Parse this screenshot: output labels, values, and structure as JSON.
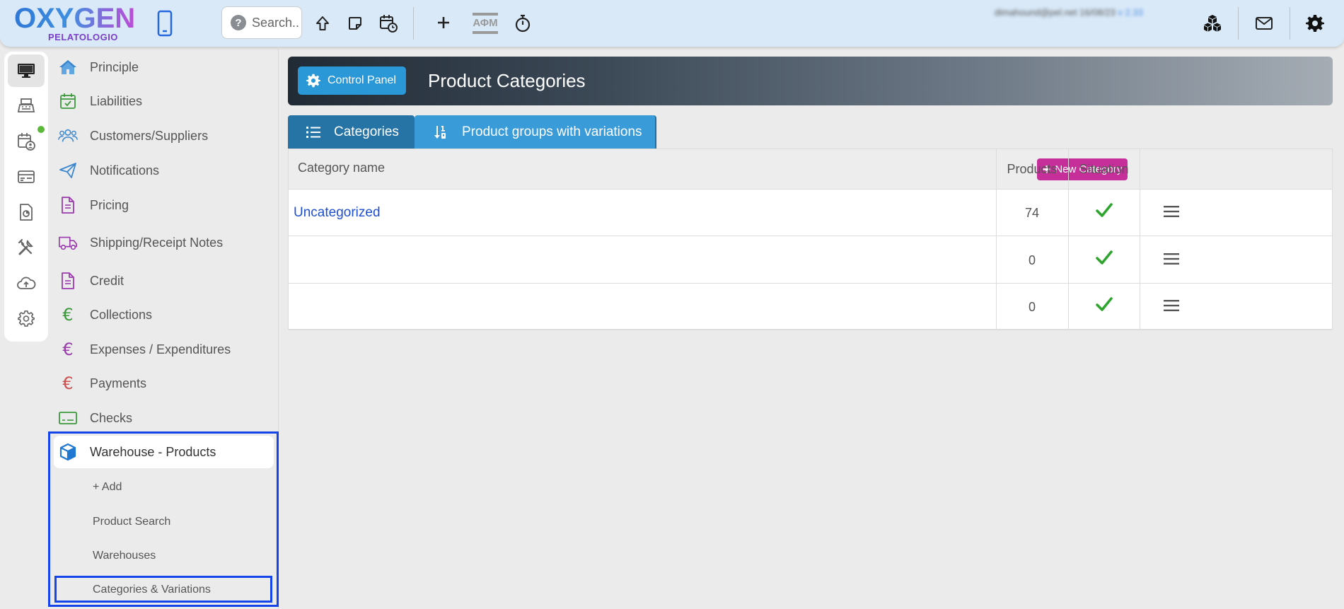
{
  "brand": {
    "name": "OXYGEN",
    "sub": "PELATOLOGIO"
  },
  "topbar": {
    "search_placeholder": "Search..",
    "afm_label": "ΑΦΜ",
    "user_email": "dimahound@pel.net 16/08/23",
    "version": "v 2.33"
  },
  "sidebar": {
    "items": [
      {
        "label": "Principle"
      },
      {
        "label": "Liabilities"
      },
      {
        "label": "Customers/Suppliers"
      },
      {
        "label": "Notifications"
      },
      {
        "label": "Pricing"
      },
      {
        "label": "Shipping/Receipt Notes"
      },
      {
        "label": "Credit"
      },
      {
        "label": "Collections"
      },
      {
        "label": "Expenses / Expenditures"
      },
      {
        "label": "Payments"
      },
      {
        "label": "Checks"
      },
      {
        "label": "Warehouse - Products"
      }
    ],
    "sub_items": [
      {
        "label": "+ Add"
      },
      {
        "label": "Product Search"
      },
      {
        "label": "Warehouses"
      },
      {
        "label": "Categories & Variations"
      }
    ]
  },
  "header": {
    "control_panel": "Control Panel",
    "title": "Product Categories"
  },
  "tabs": [
    {
      "label": "Categories"
    },
    {
      "label": "Product groups with variations"
    }
  ],
  "table": {
    "columns": {
      "name": "Category name",
      "products": "Products",
      "situation": "Situation"
    },
    "new_category": "New Category",
    "rows": [
      {
        "name": "Uncategorized",
        "products": "74",
        "active": true
      },
      {
        "name": "",
        "products": "0",
        "active": true
      },
      {
        "name": "",
        "products": "0",
        "active": true
      }
    ]
  },
  "colors": {
    "topbar": "#d9e9f8",
    "accent_blue": "#2a97d6",
    "tab_active": "#2673a6",
    "new_category": "#c62e9a",
    "check": "#2ea52e",
    "selection_outline": "#1545e8"
  }
}
